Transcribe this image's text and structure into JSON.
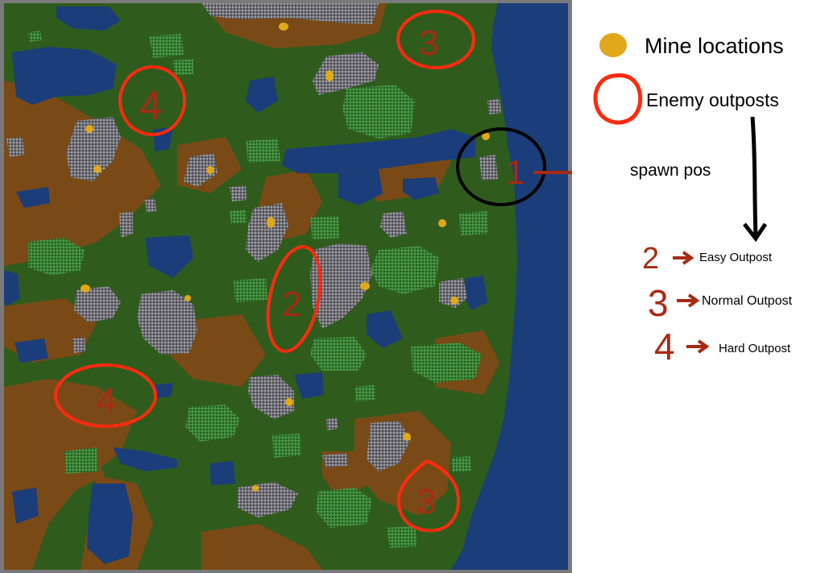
{
  "legend": {
    "mine_locations": "Mine locations",
    "enemy_outposts": "Enemy outposts",
    "spawn_pos": "spawn pos",
    "easy_outpost": "Easy Outpost",
    "normal_outpost": "Normal Outpost",
    "hard_outpost": "Hard Outpost"
  },
  "outpost_levels": [
    "2",
    "3",
    "4"
  ],
  "map_markers": {
    "spawn_number": "1",
    "outposts": [
      "3",
      "4",
      "2",
      "4",
      "3"
    ]
  },
  "colors": {
    "water": "#1b3d7a",
    "grass": "#2f5c1d",
    "dirt": "#7a4a16",
    "rock": "#7a7a80",
    "forest": "#2f7a2f",
    "mine": "#e0a81a",
    "outpost_circle": "#ff2a10",
    "outpost_number": "#a82a14",
    "spawn_circle": "#000000"
  }
}
